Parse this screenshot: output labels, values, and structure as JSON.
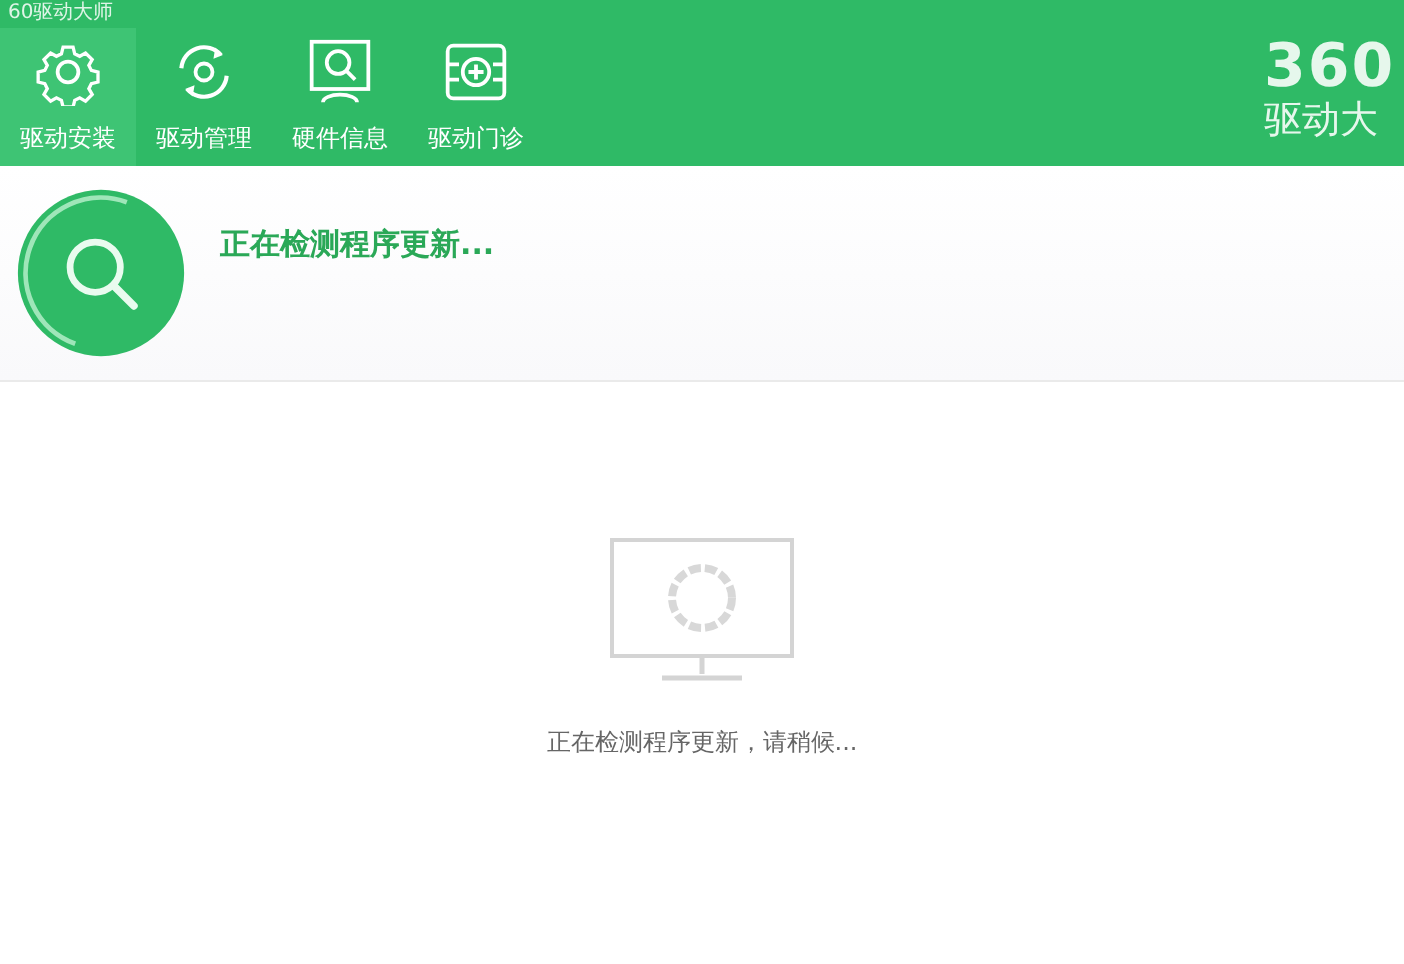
{
  "window": {
    "title": "60驱动大师"
  },
  "tabs": [
    {
      "label": "驱动安装",
      "selected": true,
      "kind": "gear"
    },
    {
      "label": "驱动管理",
      "selected": false,
      "kind": "refresh"
    },
    {
      "label": "硬件信息",
      "selected": false,
      "kind": "monitor"
    },
    {
      "label": "驱动门诊",
      "selected": false,
      "kind": "clinic"
    }
  ],
  "logo": {
    "number": "360",
    "name": "驱动大"
  },
  "status": {
    "heading": "正在检测程序更新..."
  },
  "progress": {
    "message": "正在检测程序更新，请稍候..."
  }
}
